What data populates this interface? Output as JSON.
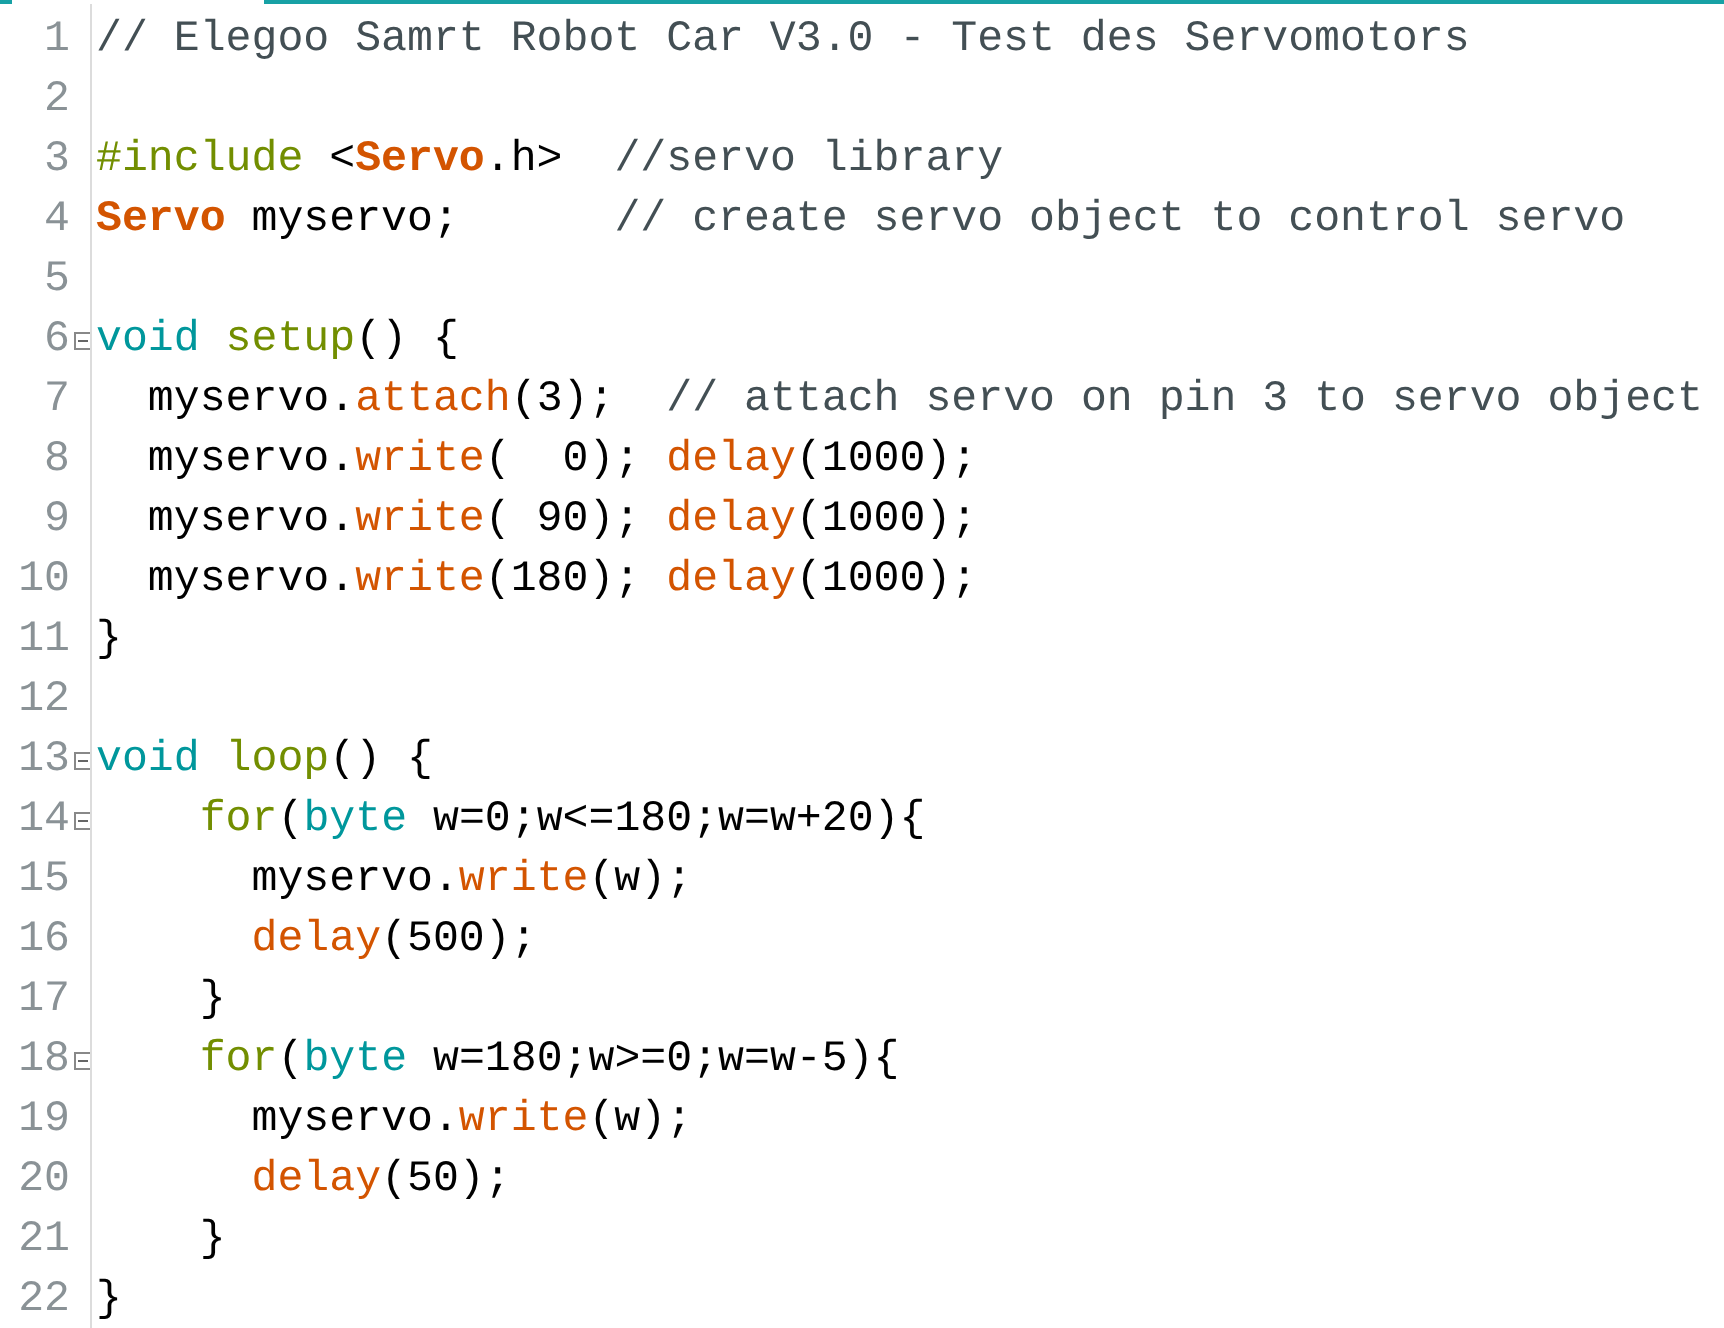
{
  "lines": [
    {
      "number": "1",
      "fold": false,
      "tokens": [
        {
          "kind": "comment",
          "text": "// Elegoo Samrt Robot Car V3.0 - Test des Servomotors"
        }
      ]
    },
    {
      "number": "2",
      "fold": false
    },
    {
      "number": "3",
      "fold": false,
      "tokens": [
        {
          "kind": "keyword",
          "text": "#include"
        },
        {
          "kind": "plain",
          "text": " <"
        },
        {
          "kind": "class",
          "text": "Servo"
        },
        {
          "kind": "plain",
          "text": ".h>  "
        },
        {
          "kind": "comment",
          "text": "//servo library"
        }
      ]
    },
    {
      "number": "4",
      "fold": false,
      "tokens": [
        {
          "kind": "class",
          "text": "Servo"
        },
        {
          "kind": "plain",
          "text": " myservo;      "
        },
        {
          "kind": "comment",
          "text": "// create servo object to control servo"
        }
      ]
    },
    {
      "number": "5",
      "fold": false
    },
    {
      "number": "6",
      "fold": true,
      "tokens": [
        {
          "kind": "type",
          "text": "void"
        },
        {
          "kind": "keyword",
          "text": " setup"
        },
        {
          "kind": "plain",
          "text": "() {"
        }
      ]
    },
    {
      "number": "7",
      "fold": false,
      "tokens": [
        {
          "kind": "plain",
          "text": "  myservo."
        },
        {
          "kind": "func",
          "text": "attach"
        },
        {
          "kind": "plain",
          "text": "(3);  "
        },
        {
          "kind": "comment",
          "text": "// attach servo on pin 3 to servo object"
        }
      ]
    },
    {
      "number": "8",
      "fold": false,
      "tokens": [
        {
          "kind": "plain",
          "text": "  myservo."
        },
        {
          "kind": "func",
          "text": "write"
        },
        {
          "kind": "plain",
          "text": "(  0); "
        },
        {
          "kind": "func",
          "text": "delay"
        },
        {
          "kind": "plain",
          "text": "(1000);"
        }
      ]
    },
    {
      "number": "9",
      "fold": false,
      "tokens": [
        {
          "kind": "plain",
          "text": "  myservo."
        },
        {
          "kind": "func",
          "text": "write"
        },
        {
          "kind": "plain",
          "text": "( 90); "
        },
        {
          "kind": "func",
          "text": "delay"
        },
        {
          "kind": "plain",
          "text": "(1000);"
        }
      ]
    },
    {
      "number": "10",
      "fold": false,
      "tokens": [
        {
          "kind": "plain",
          "text": "  myservo."
        },
        {
          "kind": "func",
          "text": "write"
        },
        {
          "kind": "plain",
          "text": "(180); "
        },
        {
          "kind": "func",
          "text": "delay"
        },
        {
          "kind": "plain",
          "text": "(1000);"
        }
      ]
    },
    {
      "number": "11",
      "fold": false,
      "tokens": [
        {
          "kind": "plain",
          "text": "}"
        }
      ]
    },
    {
      "number": "12",
      "fold": false
    },
    {
      "number": "13",
      "fold": true,
      "tokens": [
        {
          "kind": "type",
          "text": "void"
        },
        {
          "kind": "keyword",
          "text": " loop"
        },
        {
          "kind": "plain",
          "text": "() {"
        }
      ]
    },
    {
      "number": "14",
      "fold": true,
      "tokens": [
        {
          "kind": "keyword",
          "text": "    for"
        },
        {
          "kind": "plain",
          "text": "("
        },
        {
          "kind": "type",
          "text": "byte"
        },
        {
          "kind": "plain",
          "text": " w=0;w<=180;w=w+20){"
        }
      ]
    },
    {
      "number": "15",
      "fold": false,
      "tokens": [
        {
          "kind": "plain",
          "text": "      myservo."
        },
        {
          "kind": "func",
          "text": "write"
        },
        {
          "kind": "plain",
          "text": "(w);"
        }
      ]
    },
    {
      "number": "16",
      "fold": false,
      "tokens": [
        {
          "kind": "func",
          "text": "      delay"
        },
        {
          "kind": "plain",
          "text": "(500);"
        }
      ]
    },
    {
      "number": "17",
      "fold": false,
      "tokens": [
        {
          "kind": "plain",
          "text": "    }"
        }
      ]
    },
    {
      "number": "18",
      "fold": true,
      "tokens": [
        {
          "kind": "keyword",
          "text": "    for"
        },
        {
          "kind": "plain",
          "text": "("
        },
        {
          "kind": "type",
          "text": "byte"
        },
        {
          "kind": "plain",
          "text": " w=180;w>=0;w=w-5){"
        }
      ]
    },
    {
      "number": "19",
      "fold": false,
      "tokens": [
        {
          "kind": "plain",
          "text": "      myservo."
        },
        {
          "kind": "func",
          "text": "write"
        },
        {
          "kind": "plain",
          "text": "(w);"
        }
      ]
    },
    {
      "number": "20",
      "fold": false,
      "tokens": [
        {
          "kind": "func",
          "text": "      delay"
        },
        {
          "kind": "plain",
          "text": "(50);"
        }
      ]
    },
    {
      "number": "21",
      "fold": false,
      "tokens": [
        {
          "kind": "plain",
          "text": "    }"
        }
      ]
    },
    {
      "number": "22",
      "fold": false,
      "tokens": [
        {
          "kind": "plain",
          "text": "}"
        }
      ]
    }
  ]
}
